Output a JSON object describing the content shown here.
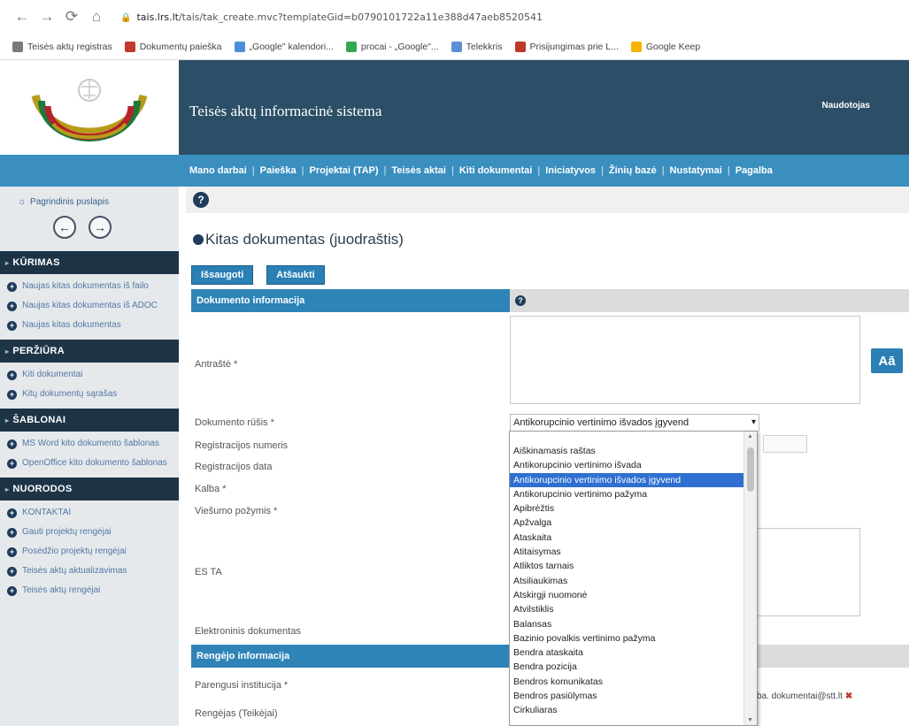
{
  "browser": {
    "nav": {
      "back": "←",
      "forward": "→",
      "reload": "⟳",
      "home": "⌂"
    },
    "url_host": "tais.lrs.lt",
    "url_path": "/tais/tak_create.mvc?templateGid=b0790101722a11e388d47aeb8520541",
    "bookmarks": [
      {
        "label": "Teisės aktų registras",
        "color": "#7a7a7a"
      },
      {
        "label": "Dokumentų paieška",
        "color": "#c0392b"
      },
      {
        "label": "„Google\" kalendori...",
        "color": "#4a90d9"
      },
      {
        "label": "procai - „Google\"...",
        "color": "#34a853"
      },
      {
        "label": "Telekkris",
        "color": "#5b8fd8"
      },
      {
        "label": "Prisijungimas prie L...",
        "color": "#c0392b"
      },
      {
        "label": "Google Keep",
        "color": "#f4b400"
      }
    ]
  },
  "header": {
    "title": "Teisės aktų informacinė sistema",
    "user": "Naudotojas"
  },
  "menu": {
    "items": [
      "Mano darbai",
      "Paieška",
      "Projektai (TAP)",
      "Teisės aktai",
      "Kiti dokumentai",
      "Iniciatyvos",
      "Žinių bazė",
      "Nustatymai",
      "Pagalba"
    ]
  },
  "sidebar": {
    "home": "Pagrindinis puslapis",
    "sections": [
      {
        "title": "KŪRIMAS",
        "items": [
          "Naujas kitas dokumentas iš failo",
          "Naujas kitas dokumentas iš ADOC",
          "Naujas kitas dokumentas"
        ]
      },
      {
        "title": "PERŽIŪRA",
        "items": [
          "Kiti dokumentai",
          "Kitų dokumentų sąrašas"
        ]
      },
      {
        "title": "ŠABLONAI",
        "items": [
          "MS Word kito dokumento šablonas",
          "OpenOffice kito dokumento šablonas"
        ]
      },
      {
        "title": "NUORODOS",
        "items": [
          "KONTAKTAI",
          "Gauti projektų rengėjai",
          "Posėdžio projektų rengėjai",
          "Teisės aktų aktualizavimas",
          "Teisės aktų rengėjai"
        ]
      }
    ]
  },
  "main": {
    "title": "Kitas dokumentas (juodraštis)",
    "actions": {
      "save": "Išsaugoti",
      "cancel": "Atšaukti"
    },
    "section_doc": "Dokumento informacija",
    "section_author": "Rengėjo informacija",
    "fields": {
      "antraste": "Antraštė *",
      "dok_rusis": "Dokumento rūšis *",
      "reg_nr": "Registracijos numeris",
      "reg_data": "Registracijos data",
      "kalba": "Kalba *",
      "viesumo": "Viešumo požymis *",
      "es_ta": "ES TA",
      "el_dok": "Elektroninis dokumentas",
      "parengusi": "Parengusi institucija *",
      "rengejas": "Rengėjas (Teikėjai)"
    },
    "select_value": "Antikorupcinio vertinimo išvados įgyvend",
    "aa_button": "Aā",
    "email": "ba. dokumentai@stt.lt"
  },
  "dropdown": {
    "selected_index": 2,
    "options": [
      "Aiškinamasis raštas",
      "Antikorupcinio vertinimo išvada",
      "Antikorupcinio vertinimo išvados įgyvend",
      "Antikorupcinio vertinimo pažyma",
      "Apibrėžtis",
      "Apžvalga",
      "Ataskaita",
      "Atitaisymas",
      "Atliktos tarnais",
      "Atsiliaukimas",
      "Atskirgji nuomonė",
      "Atvilstiklis",
      "Balansas",
      "Bazinio povalkis vertinimo pažyma",
      "Bendra ataskaita",
      "Bendra pozicija",
      "Bendros komunikatas",
      "Bendros pasiūlymas",
      "Cirkuliaras"
    ]
  }
}
